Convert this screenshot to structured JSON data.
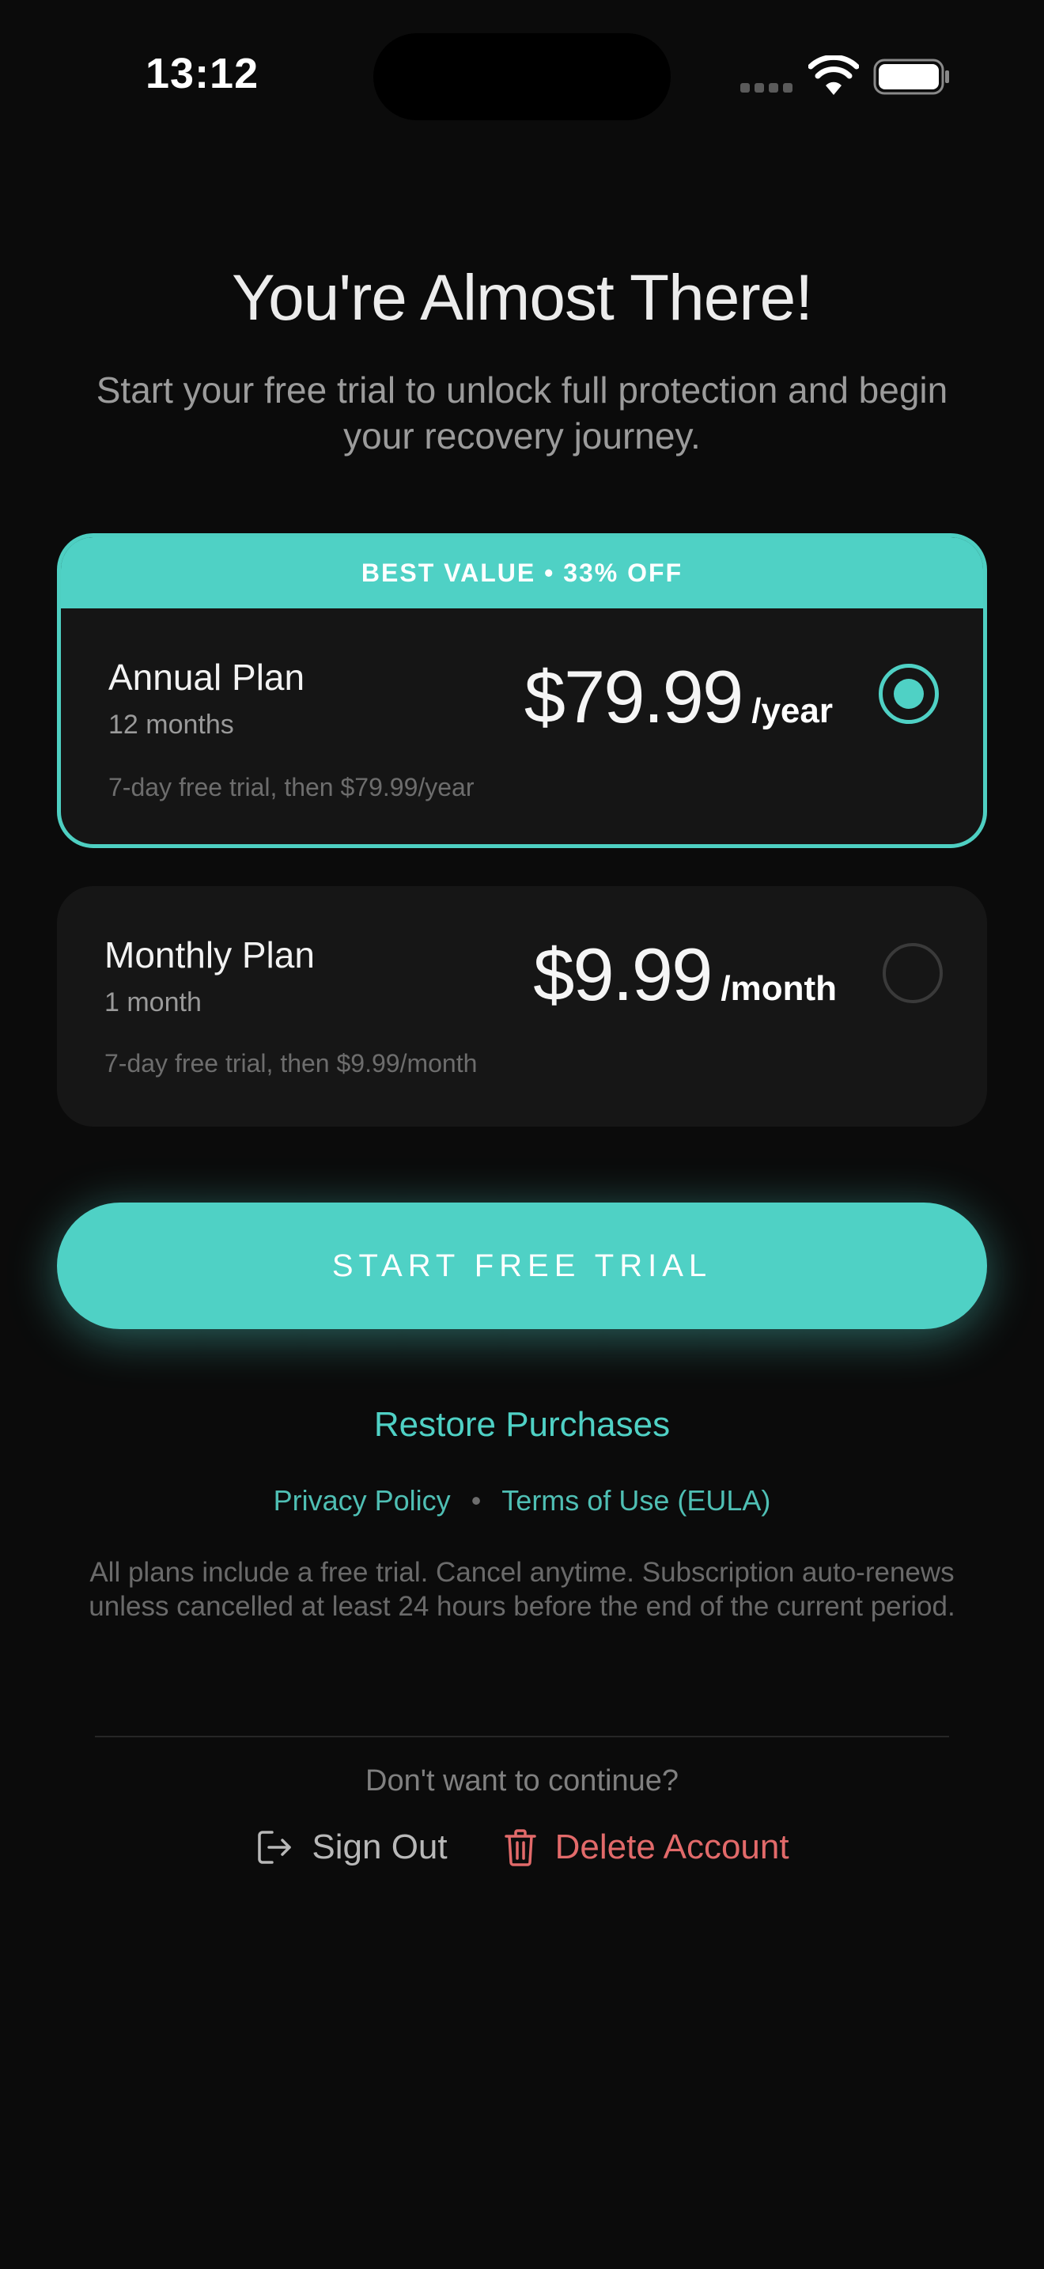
{
  "status_bar": {
    "time": "13:12"
  },
  "header": {
    "title": "You're Almost There!",
    "subtitle": "Start your free trial to unlock full protection and begin your recovery journey."
  },
  "plans": [
    {
      "badge": "BEST VALUE • 33% OFF",
      "name": "Annual Plan",
      "duration": "12 months",
      "price": "$79.99",
      "period": "/year",
      "trial_note": "7-day free trial, then $79.99/year",
      "selected": true
    },
    {
      "name": "Monthly Plan",
      "duration": "1 month",
      "price": "$9.99",
      "period": "/month",
      "trial_note": "7-day free trial, then $9.99/month",
      "selected": false
    }
  ],
  "cta": {
    "label": "START FREE TRIAL"
  },
  "restore": {
    "label": "Restore Purchases"
  },
  "legal": {
    "privacy_label": "Privacy Policy",
    "separator": "•",
    "terms_label": "Terms of Use (EULA)",
    "disclaimer": "All plans include a free trial. Cancel anytime. Subscription auto-renews unless cancelled at least 24 hours before the end of the current period."
  },
  "exit": {
    "prompt": "Don't want to continue?",
    "sign_out_label": "Sign Out",
    "delete_label": "Delete Account"
  },
  "icons": {
    "wifi": "wifi-icon",
    "battery": "battery-icon",
    "sign_out": "sign-out-icon",
    "trash": "trash-icon"
  },
  "colors": {
    "background": "#0b0b0b",
    "accent": "#4fd1c5",
    "card": "#161616",
    "destructive": "#e26a6a"
  }
}
